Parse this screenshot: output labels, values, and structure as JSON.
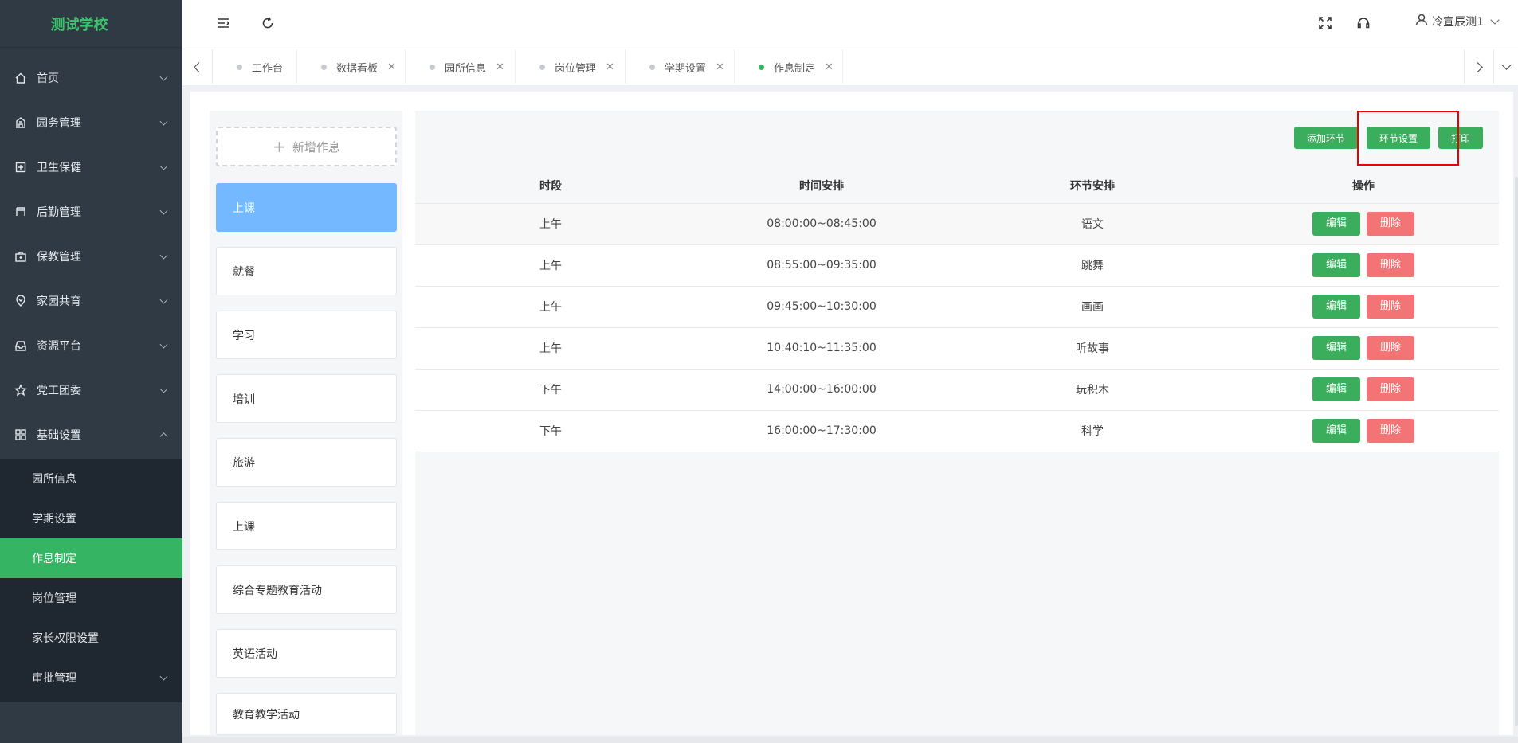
{
  "sidebar": {
    "logo": "测试学校",
    "menu": [
      {
        "label": "首页",
        "icon": "home-icon"
      },
      {
        "label": "园务管理",
        "icon": "building-icon"
      },
      {
        "label": "卫生保健",
        "icon": "health-icon"
      },
      {
        "label": "后勤管理",
        "icon": "logistics-icon"
      },
      {
        "label": "保教管理",
        "icon": "briefcase-icon"
      },
      {
        "label": "家园共育",
        "icon": "location-heart-icon"
      },
      {
        "label": "资源平台",
        "icon": "inbox-icon"
      },
      {
        "label": "党工团委",
        "icon": "star-icon"
      },
      {
        "label": "基础设置",
        "icon": "grid-icon"
      }
    ],
    "submenu": [
      {
        "label": "园所信息"
      },
      {
        "label": "学期设置"
      },
      {
        "label": "作息制定"
      },
      {
        "label": "岗位管理"
      },
      {
        "label": "家长权限设置"
      },
      {
        "label": "审批管理"
      }
    ]
  },
  "header": {
    "user": "冷宣辰测1"
  },
  "tabs": [
    {
      "label": "工作台",
      "closable": false
    },
    {
      "label": "数据看板",
      "closable": true
    },
    {
      "label": "园所信息",
      "closable": true
    },
    {
      "label": "岗位管理",
      "closable": true
    },
    {
      "label": "学期设置",
      "closable": true
    },
    {
      "label": "作息制定",
      "closable": true,
      "active": true
    }
  ],
  "schedules": {
    "add_label": "新增作息",
    "items": [
      "上课",
      "就餐",
      "学习",
      "培训",
      "旅游",
      "上课",
      "综合专题教育活动",
      "英语活动",
      "教育教学活动"
    ]
  },
  "toolbar": {
    "add_label": "添加环节",
    "settings_label": "环节设置",
    "print_label": "打印"
  },
  "table": {
    "headers": [
      "时段",
      "时间安排",
      "环节安排",
      "操作"
    ],
    "rows": [
      {
        "period": "上午",
        "time": "08:00:00~08:45:00",
        "activity": "语文"
      },
      {
        "period": "上午",
        "time": "08:55:00~09:35:00",
        "activity": "跳舞"
      },
      {
        "period": "上午",
        "time": "09:45:00~10:30:00",
        "activity": "画画"
      },
      {
        "period": "上午",
        "time": "10:40:10~11:35:00",
        "activity": "听故事"
      },
      {
        "period": "下午",
        "time": "14:00:00~16:00:00",
        "activity": "玩积木"
      },
      {
        "period": "下午",
        "time": "16:00:00~17:30:00",
        "activity": "科学"
      }
    ],
    "edit_label": "编辑",
    "delete_label": "删除"
  }
}
